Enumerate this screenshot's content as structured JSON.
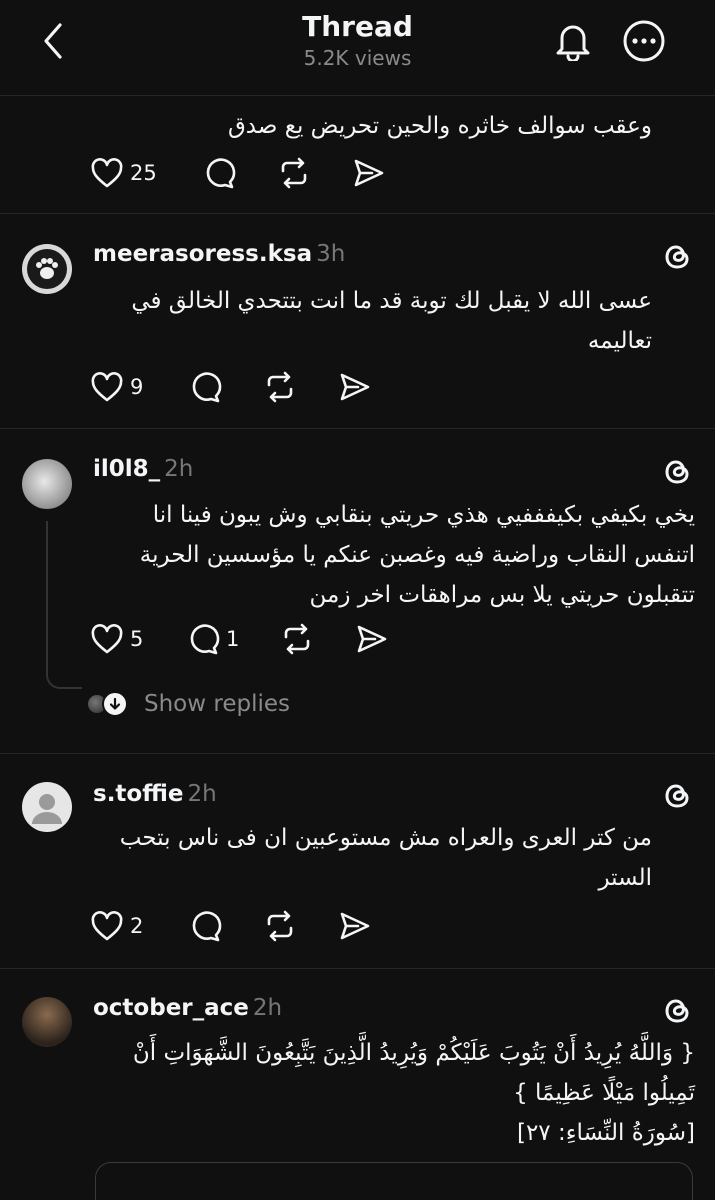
{
  "header": {
    "title": "Thread",
    "views": "5.2K views"
  },
  "posts": [
    {
      "text": "وعقب سوالف خاثره والحين تحريض يع صدق",
      "likes": "25"
    },
    {
      "username": "meerasoress.ksa",
      "time": "3h",
      "text": "عسى الله لا يقبل لك توبة قد ما انت بتتحدي الخالق في\nتعاليمه",
      "likes": "9"
    },
    {
      "username": "il0l8_",
      "time": "2h",
      "text": "يخي بكيفي بكيفففيي هذي حريتي بنقابي وش يبون فينا انا\nاتنفس النقاب وراضية فيه وغصبن عنكم يا مؤسسين الحرية\nتتقبلون حريتي يلا بس مراهقات اخر زمن",
      "likes": "5",
      "replies": "1",
      "show_replies": "Show replies"
    },
    {
      "username": "s.toffie",
      "time": "2h",
      "text": "من كتر العرى والعراه مش مستوعبين ان فى ناس بتحب\nالستر",
      "likes": "2"
    },
    {
      "username": "october_ace",
      "time": "2h",
      "text": "{ وَاللَّهُ يُرِيدُ أَنْ يَتُوبَ عَلَيْكُمْ وَيُرِيدُ الَّذِينَ يَتَّبِعُونَ الشَّهَوَاتِ أَنْ\nتَمِيلُوا مَيْلًا عَظِيمًا }\n[سُورَةُ النِّسَاءِ: ٢٧]"
    }
  ],
  "colors": {
    "background": "#101010",
    "text": "#f3f5f7",
    "muted": "#8a8a8a",
    "divider": "#262626"
  }
}
